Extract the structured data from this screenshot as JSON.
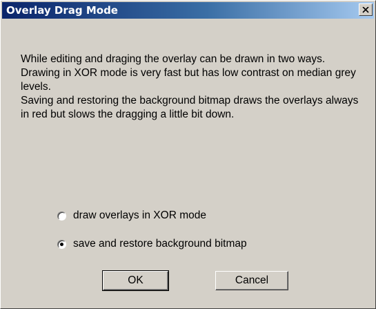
{
  "dialog": {
    "title": "Overlay Drag Mode",
    "close_glyph": "✕",
    "description": [
      "While editing and draging the overlay can be drawn in two ways.",
      "Drawing in XOR mode is very fast but has low contrast on median grey levels.",
      "Saving and restoring the background bitmap draws the overlays always in red but slows the dragging a little bit down."
    ],
    "options": [
      {
        "label": "draw overlays in XOR mode",
        "checked": false
      },
      {
        "label": "save and restore background bitmap",
        "checked": true
      }
    ],
    "ok_label": "OK",
    "cancel_label": "Cancel"
  },
  "colors": {
    "face": "#d4d0c8",
    "title_active": "#0a246a",
    "title_gradient_end": "#a6caf0"
  },
  "icons": {
    "close": "close-icon",
    "radio": "radio-icon"
  }
}
